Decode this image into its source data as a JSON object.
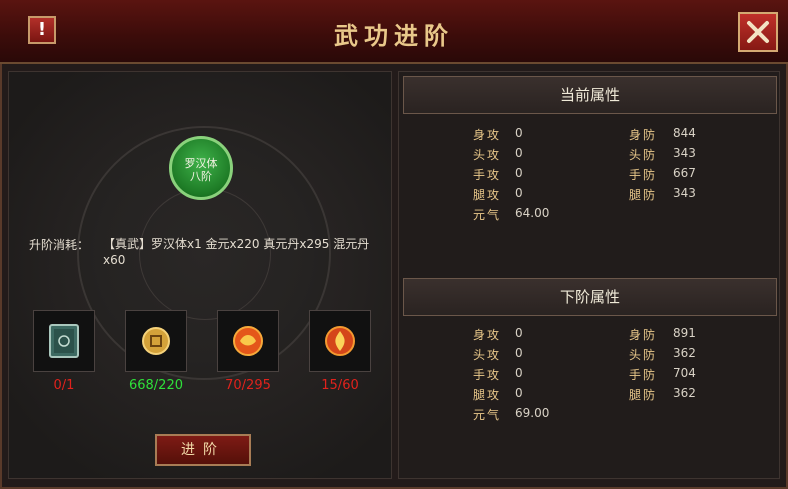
{
  "title": "武功进阶",
  "warning_label": "!",
  "node": {
    "line1": "罗汉体",
    "line2": "八阶"
  },
  "cost": {
    "label": "升阶消耗：",
    "value": "【真武】罗汉体x1 金元x220 真元丹x295 混元丹x60"
  },
  "materials": [
    {
      "icon": "book-icon",
      "count": "0/1",
      "status": "insufficient"
    },
    {
      "icon": "gold-coin-icon",
      "count": "668/220",
      "status": "sufficient"
    },
    {
      "icon": "fire-pill-icon",
      "count": "70/295",
      "status": "insufficient"
    },
    {
      "icon": "flame-orb-icon",
      "count": "15/60",
      "status": "insufficient"
    }
  ],
  "advance_button": "进阶",
  "current": {
    "header": "当前属性",
    "attrs": [
      {
        "label": "身攻",
        "value": "0"
      },
      {
        "label": "身防",
        "value": "844"
      },
      {
        "label": "头攻",
        "value": "0"
      },
      {
        "label": "头防",
        "value": "343"
      },
      {
        "label": "手攻",
        "value": "0"
      },
      {
        "label": "手防",
        "value": "667"
      },
      {
        "label": "腿攻",
        "value": "0"
      },
      {
        "label": "腿防",
        "value": "343"
      },
      {
        "label": "元气",
        "value": "64.00"
      }
    ]
  },
  "next": {
    "header": "下阶属性",
    "attrs": [
      {
        "label": "身攻",
        "value": "0"
      },
      {
        "label": "身防",
        "value": "891"
      },
      {
        "label": "头攻",
        "value": "0"
      },
      {
        "label": "头防",
        "value": "362"
      },
      {
        "label": "手攻",
        "value": "0"
      },
      {
        "label": "手防",
        "value": "704"
      },
      {
        "label": "腿攻",
        "value": "0"
      },
      {
        "label": "腿防",
        "value": "362"
      },
      {
        "label": "元气",
        "value": "69.00"
      }
    ]
  },
  "colors": {
    "title": "#e9c88a",
    "insufficient": "#e0221c",
    "sufficient": "#2ee03a"
  }
}
